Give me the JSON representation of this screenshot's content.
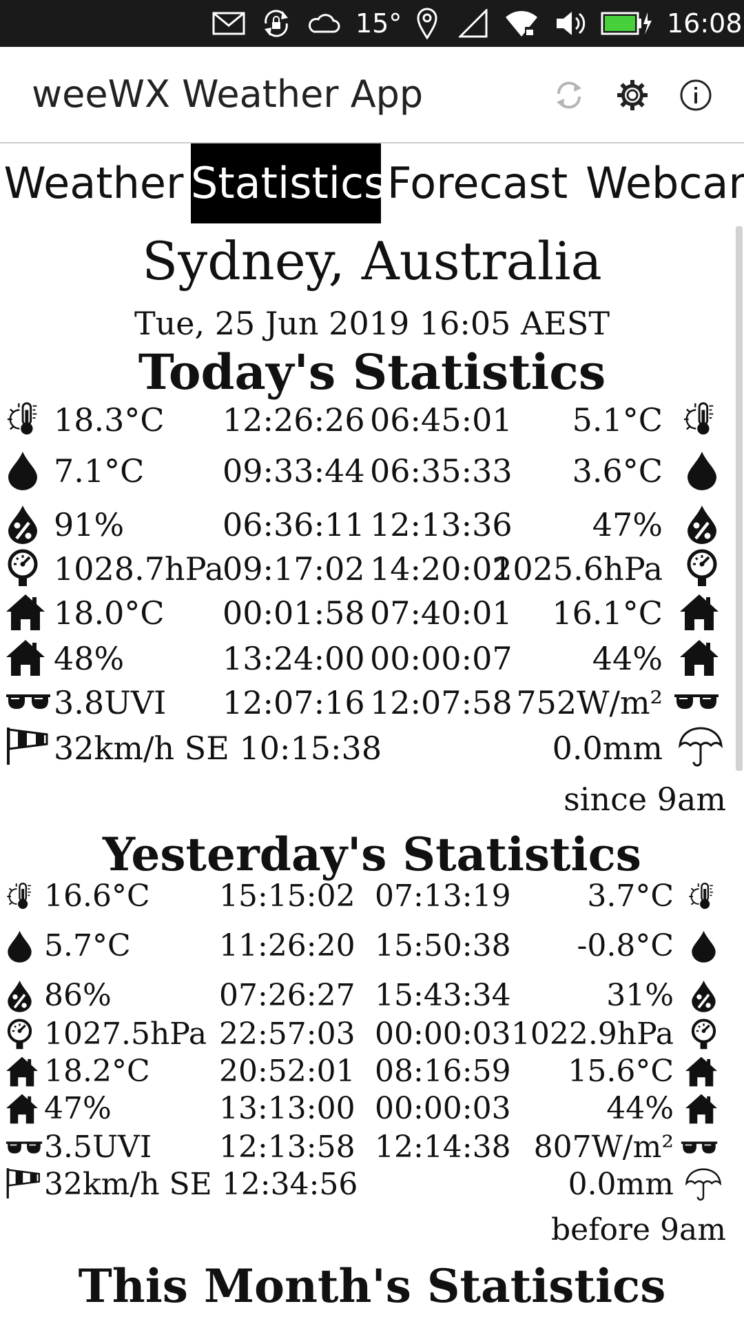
{
  "status_bar": {
    "icons": [
      "mail-icon",
      "sync-lock-icon",
      "cloud-icon",
      "location-icon",
      "cell-signal-icon",
      "wifi-icon",
      "volume-icon",
      "battery-charging-icon"
    ],
    "temperature": "15°",
    "time": "16:08"
  },
  "app_bar": {
    "title": "weeWX Weather App",
    "actions": [
      "refresh-icon",
      "settings-gear-icon",
      "info-icon"
    ]
  },
  "tabs": [
    {
      "label": "Weather",
      "active": false
    },
    {
      "label": "Statistics",
      "active": true
    },
    {
      "label": "Forecast",
      "active": false
    },
    {
      "label": "Webcam",
      "active": false
    }
  ],
  "station": "Sydney, Australia",
  "datetime": "Tue, 25 Jun 2019 16:05 AEST",
  "sections": [
    {
      "heading": "Today's Statistics",
      "rows": [
        {
          "icon": "temperature-icon",
          "max": "18.3°C",
          "max_time": "12:26:26",
          "min_time": "06:45:01",
          "min": "5.1°C"
        },
        {
          "icon": "dewpoint-icon",
          "max": "7.1°C",
          "max_time": "09:33:44",
          "min_time": "06:35:33",
          "min": "3.6°C"
        },
        {
          "icon": "humidity-icon",
          "max": "91%",
          "max_time": "06:36:11",
          "min_time": "12:13:36",
          "min": "47%"
        },
        {
          "icon": "barometer-icon",
          "max": "1028.7hPa",
          "max_time": "09:17:02",
          "min_time": "14:20:02",
          "min": "1025.6hPa"
        },
        {
          "icon": "indoor-temperature-icon",
          "max": "18.0°C",
          "max_time": "00:01:58",
          "min_time": "07:40:01",
          "min": "16.1°C"
        },
        {
          "icon": "indoor-humidity-icon",
          "max": "48%",
          "max_time": "13:24:00",
          "min_time": "00:00:07",
          "min": "44%"
        },
        {
          "icon": "uv-sunglasses-icon",
          "max": "3.8UVI",
          "max_time": "12:07:16",
          "min_time": "12:07:58",
          "min": "752W/m²"
        }
      ],
      "wind": {
        "icon": "windsock-icon",
        "text": "32km/h SE 10:15:38"
      },
      "rain": {
        "icon": "umbrella-icon",
        "amount": "0.0mm",
        "note": "since 9am"
      }
    },
    {
      "heading": "Yesterday's Statistics",
      "rows": [
        {
          "icon": "temperature-icon",
          "max": "16.6°C",
          "max_time": "15:15:02",
          "min_time": "07:13:19",
          "min": "3.7°C"
        },
        {
          "icon": "dewpoint-icon",
          "max": "5.7°C",
          "max_time": "11:26:20",
          "min_time": "15:50:38",
          "min": "-0.8°C"
        },
        {
          "icon": "humidity-icon",
          "max": "86%",
          "max_time": "07:26:27",
          "min_time": "15:43:34",
          "min": "31%"
        },
        {
          "icon": "barometer-icon",
          "max": "1027.5hPa",
          "max_time": "22:57:03",
          "min_time": "00:00:03",
          "min": "1022.9hPa"
        },
        {
          "icon": "indoor-temperature-icon",
          "max": "18.2°C",
          "max_time": "20:52:01",
          "min_time": "08:16:59",
          "min": "15.6°C"
        },
        {
          "icon": "indoor-humidity-icon",
          "max": "47%",
          "max_time": "13:13:00",
          "min_time": "00:00:03",
          "min": "44%"
        },
        {
          "icon": "uv-sunglasses-icon",
          "max": "3.5UVI",
          "max_time": "12:13:58",
          "min_time": "12:14:38",
          "min": "807W/m²"
        }
      ],
      "wind": {
        "icon": "windsock-icon",
        "text": "32km/h SE 12:34:56"
      },
      "rain": {
        "icon": "umbrella-icon",
        "amount": "0.0mm",
        "note": "before 9am"
      }
    },
    {
      "heading": "This Month's Statistics"
    }
  ]
}
